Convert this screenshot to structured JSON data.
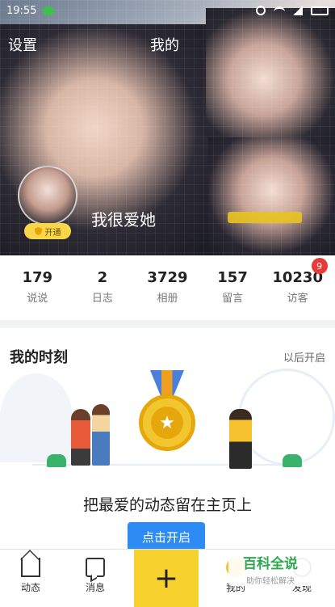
{
  "status_bar": {
    "time": "19:55"
  },
  "top_nav": {
    "settings_label": "设置",
    "title": "我的"
  },
  "profile": {
    "nickname": "我很爱她",
    "badge_text": "开通"
  },
  "stats": [
    {
      "value": "179",
      "label": "说说"
    },
    {
      "value": "2",
      "label": "日志"
    },
    {
      "value": "3729",
      "label": "相册"
    },
    {
      "value": "157",
      "label": "留言"
    },
    {
      "value": "10230",
      "label": "访客",
      "badge": "9"
    }
  ],
  "moments": {
    "title": "我的时刻",
    "later_label": "以后开启",
    "headline": "把最爱的动态留在主页上",
    "open_button": "点击开启"
  },
  "tabbar": {
    "feed": "动态",
    "messages": "消息",
    "plus": "+",
    "me": "我的",
    "discover": "发现"
  },
  "watermark": {
    "line1": "百科全说",
    "line2": "助你轻松解决"
  },
  "colors": {
    "accent_blue": "#2c8cf4",
    "accent_yellow": "#f7d22e",
    "badge_red": "#e73a3a"
  }
}
